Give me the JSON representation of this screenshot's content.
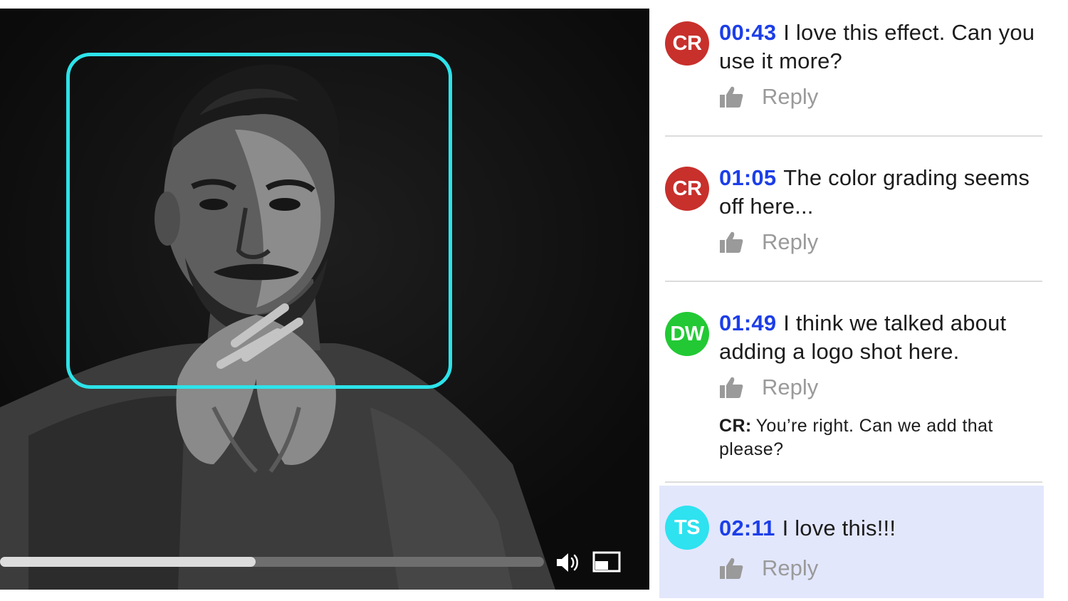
{
  "video": {
    "progress_percent": 47,
    "icons": {
      "volume": "speaker-icon",
      "pip": "picture-in-picture-icon"
    },
    "focus_color": "#2de3ea"
  },
  "comments": [
    {
      "initials": "CR",
      "avatar_color": "#c8302c",
      "timestamp": "00:43",
      "text": "I love this effect. Can you use it more?",
      "reply_label": "Reply"
    },
    {
      "initials": "CR",
      "avatar_color": "#c8302c",
      "timestamp": "01:05",
      "text": "The color grading seems off here...",
      "reply_label": "Reply"
    },
    {
      "initials": "DW",
      "avatar_color": "#22c934",
      "timestamp": "01:49",
      "text": "I think we talked about adding a logo shot here.",
      "reply_label": "Reply",
      "sub_reply": {
        "author": "CR:",
        "text": "You’re right. Can we add that please?"
      }
    },
    {
      "initials": "TS",
      "avatar_color": "#2ee2f0",
      "timestamp": "02:11",
      "text": "I love this!!!",
      "reply_label": "Reply"
    }
  ],
  "colors": {
    "timestamp": "#1c3ee8",
    "highlight": "#e3e7fc",
    "reply": "#9a9a9a"
  }
}
